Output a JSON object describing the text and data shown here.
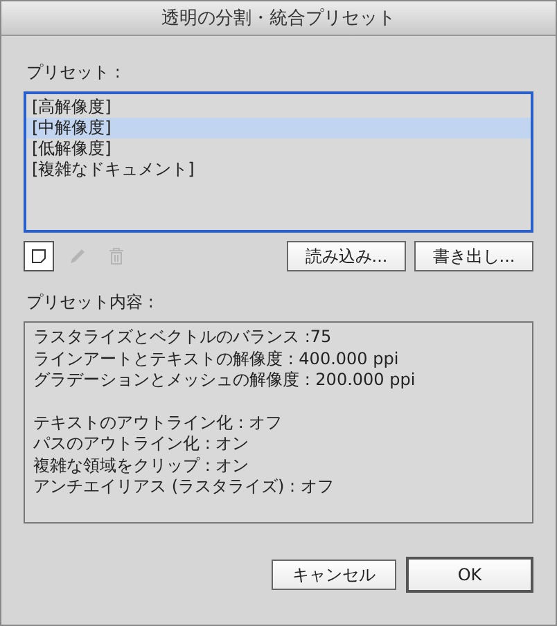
{
  "window": {
    "title": "透明の分割・統合プリセット"
  },
  "presets": {
    "label": "プリセット :",
    "items": [
      {
        "label": "[高解像度]",
        "selected": false
      },
      {
        "label": "[中解像度]",
        "selected": true
      },
      {
        "label": "[低解像度]",
        "selected": false
      },
      {
        "label": "[複雑なドキュメント]",
        "selected": false
      }
    ]
  },
  "tools": [
    {
      "kind": "new",
      "disabled": false
    },
    {
      "kind": "edit",
      "disabled": true
    },
    {
      "kind": "delete",
      "disabled": true
    }
  ],
  "file_buttons": [
    "読み込み...",
    "書き出し..."
  ],
  "details": {
    "label": "プリセット内容 :",
    "groups": [
      [
        "ラスタライズとベクトルのバランス :75",
        "ラインアートとテキストの解像度 : 400.000 ppi",
        "グラデーションとメッシュの解像度 : 200.000 ppi"
      ],
      [
        "テキストのアウトライン化 : オフ",
        "パスのアウトライン化 : オン",
        "複雑な領域をクリップ : オン",
        "アンチエイリアス (ラスタライズ) : オフ"
      ]
    ]
  },
  "buttons": [
    {
      "label": "キャンセル",
      "kind": "cancel"
    },
    {
      "label": "OK",
      "kind": "default"
    }
  ]
}
